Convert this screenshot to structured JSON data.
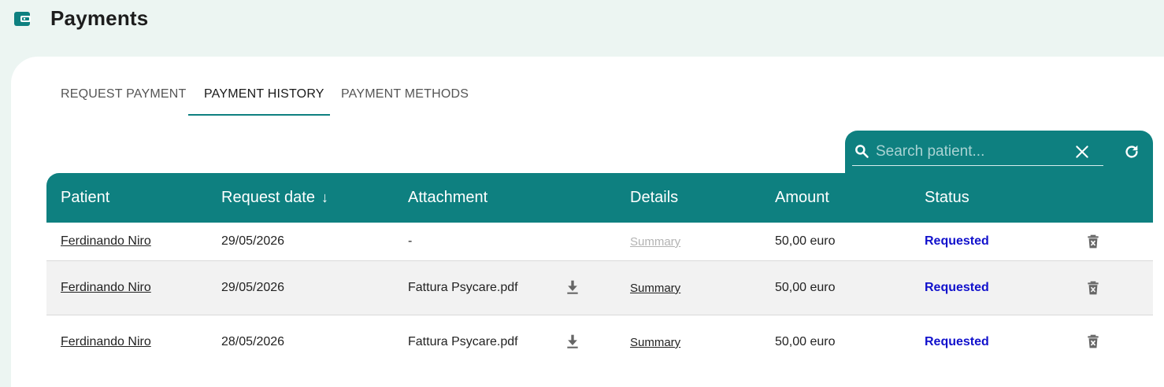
{
  "header": {
    "title": "Payments",
    "logo_icon": "wallet-icon"
  },
  "tabs": [
    {
      "label": "REQUEST PAYMENT",
      "active": false
    },
    {
      "label": "PAYMENT HISTORY",
      "active": true
    },
    {
      "label": "PAYMENT METHODS",
      "active": false
    }
  ],
  "search": {
    "placeholder": "Search patient...",
    "value": ""
  },
  "table": {
    "columns": [
      "Patient",
      "Request date",
      "Attachment",
      "Details",
      "Amount",
      "Status"
    ],
    "sort_icon": "arrow-down-icon",
    "rows": [
      {
        "patient": "Ferdinando Niro",
        "date": "29/05/2026",
        "attachment": "-",
        "details": "Summary",
        "details_enabled": false,
        "amount": "50,00 euro",
        "status": "Requested"
      },
      {
        "patient": "Ferdinando Niro",
        "date": "29/05/2026",
        "attachment": "Fattura Psycare.pdf",
        "details": "Summary",
        "details_enabled": true,
        "amount": "50,00 euro",
        "status": "Requested"
      },
      {
        "patient": "Ferdinando Niro",
        "date": "28/05/2026",
        "attachment": "Fattura Psycare.pdf",
        "details": "Summary",
        "details_enabled": true,
        "amount": "50,00 euro",
        "status": "Requested"
      }
    ]
  },
  "colors": {
    "accent": "#0e8080",
    "status": "#1111cc",
    "background": "#ecf5f2"
  }
}
